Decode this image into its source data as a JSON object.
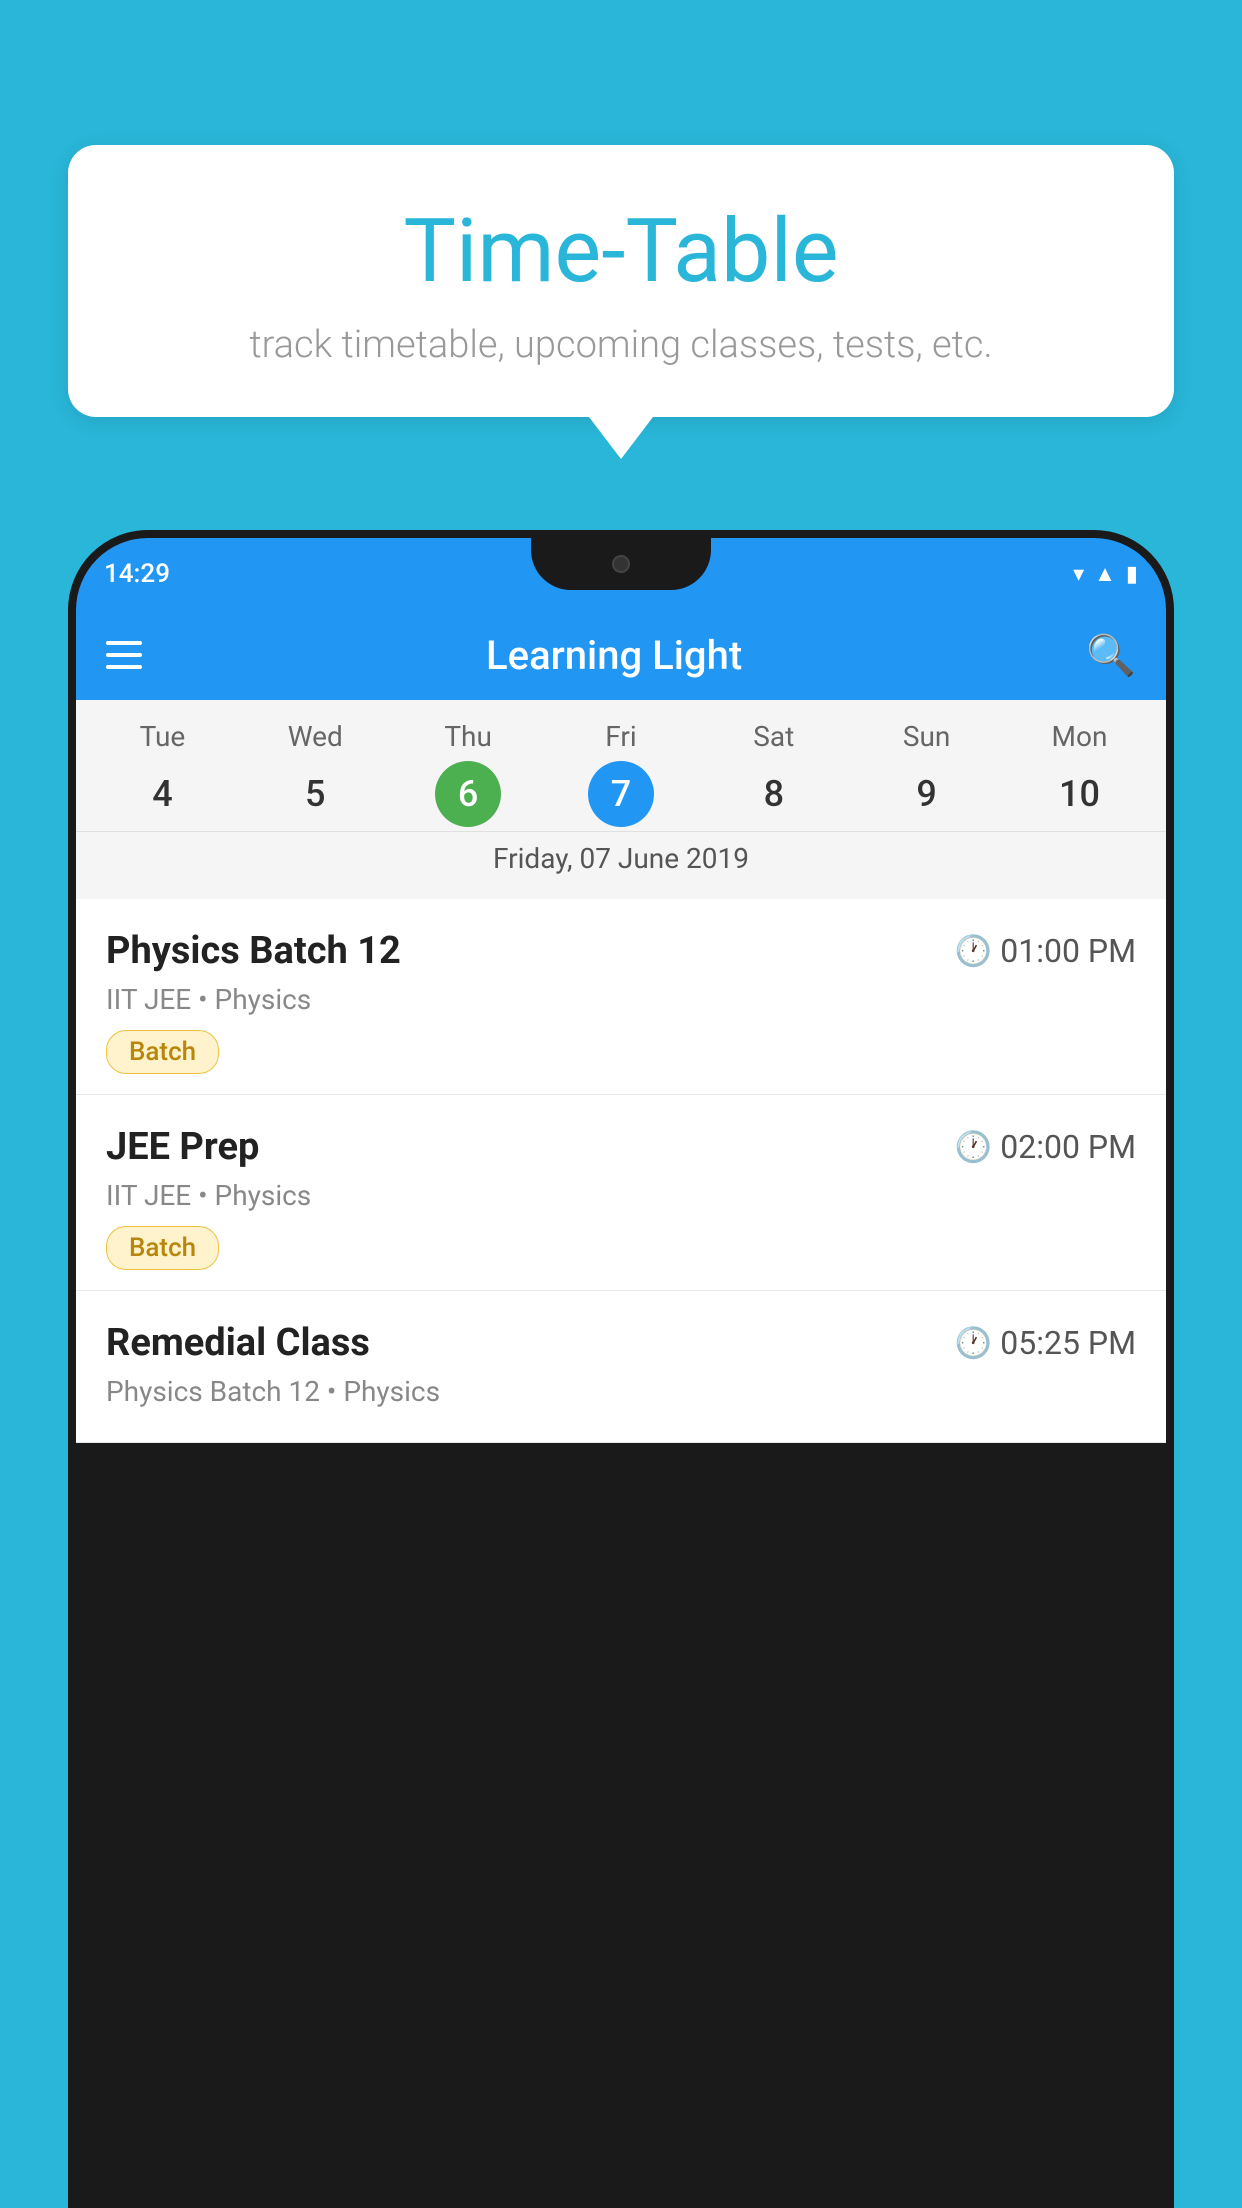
{
  "background_color": "#29B6D8",
  "speech_bubble": {
    "title": "Time-Table",
    "subtitle": "track timetable, upcoming classes, tests, etc."
  },
  "phone": {
    "status_bar": {
      "time": "14:29",
      "icons": [
        "wifi",
        "signal",
        "battery"
      ]
    },
    "app_bar": {
      "title": "Learning Light",
      "menu_label": "Menu",
      "search_label": "Search"
    },
    "calendar": {
      "days": [
        {
          "name": "Tue",
          "num": "4",
          "state": "normal"
        },
        {
          "name": "Wed",
          "num": "5",
          "state": "normal"
        },
        {
          "name": "Thu",
          "num": "6",
          "state": "today"
        },
        {
          "name": "Fri",
          "num": "7",
          "state": "selected"
        },
        {
          "name": "Sat",
          "num": "8",
          "state": "normal"
        },
        {
          "name": "Sun",
          "num": "9",
          "state": "normal"
        },
        {
          "name": "Mon",
          "num": "10",
          "state": "normal"
        }
      ],
      "selected_date_label": "Friday, 07 June 2019"
    },
    "schedule_items": [
      {
        "title": "Physics Batch 12",
        "time": "01:00 PM",
        "subtitle": "IIT JEE • Physics",
        "badge": "Batch"
      },
      {
        "title": "JEE Prep",
        "time": "02:00 PM",
        "subtitle": "IIT JEE • Physics",
        "badge": "Batch"
      },
      {
        "title": "Remedial Class",
        "time": "05:25 PM",
        "subtitle": "Physics Batch 12 • Physics",
        "badge": ""
      }
    ]
  }
}
